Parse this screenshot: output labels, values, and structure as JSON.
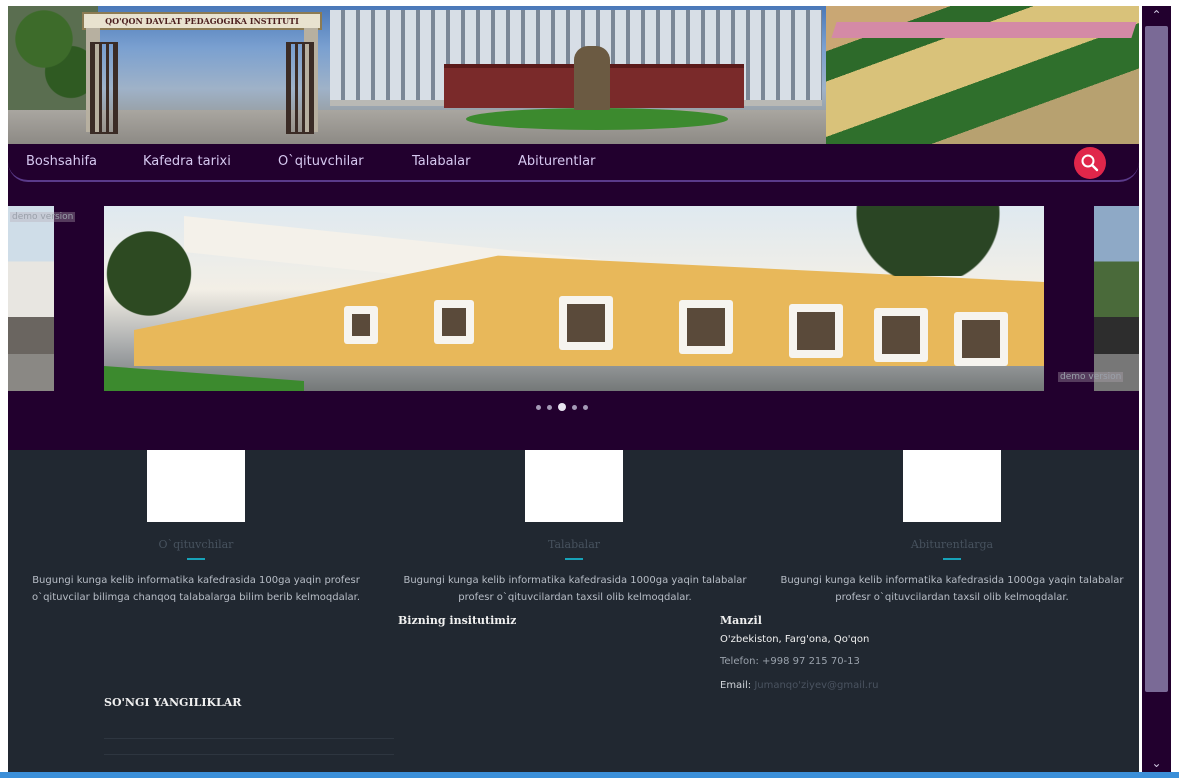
{
  "header": {
    "banner_text": "QO'QON DAVLAT PEDAGOGIKA INSTITUTI"
  },
  "nav": {
    "items": [
      {
        "label": "Boshsahifa"
      },
      {
        "label": "Kafedra tarixi"
      },
      {
        "label": "O`qituvchilar"
      },
      {
        "label": "Talabalar"
      },
      {
        "label": "Abiturentlar"
      }
    ],
    "search_icon": "search-icon"
  },
  "slider": {
    "watermark": "demo version",
    "dots": 5,
    "active_dot": 3
  },
  "cards": [
    {
      "title": "O`qituvchilar",
      "text": "Bugungi kunga kelib informatika kafedrasida 100ga yaqin profesr o`qituvcilar bilimga chanqoq talabalarga bilim berib kelmoqdalar."
    },
    {
      "title": "Talabalar",
      "text": "Bugungi kunga kelib informatika kafedrasida 1000ga yaqin talabalar profesr o`qituvcilardan taxsil olib kelmoqdalar."
    },
    {
      "title": "Abiturentlarga",
      "text": "Bugungi kunga kelib informatika kafedrasida 1000ga yaqin talabalar profesr o`qituvcilardan taxsil olib kelmoqdalar."
    }
  ],
  "sections": {
    "institute_title": "Bizning insitutimiz",
    "news_title": "SO'NGI YANGILIKLAR",
    "address_title": "Manzil",
    "address": "O'zbekiston, Farg'ona, Qo'qon",
    "phone": "Telefon: +998 97 215 70-13",
    "email_label": "Email:",
    "email_value": "Jumanqo'ziyev@gmail.ru"
  },
  "colors": {
    "nav_bg": "#22002e",
    "content_bg": "#212831",
    "accent": "#17a2b8",
    "search_button": "#e0264a"
  }
}
